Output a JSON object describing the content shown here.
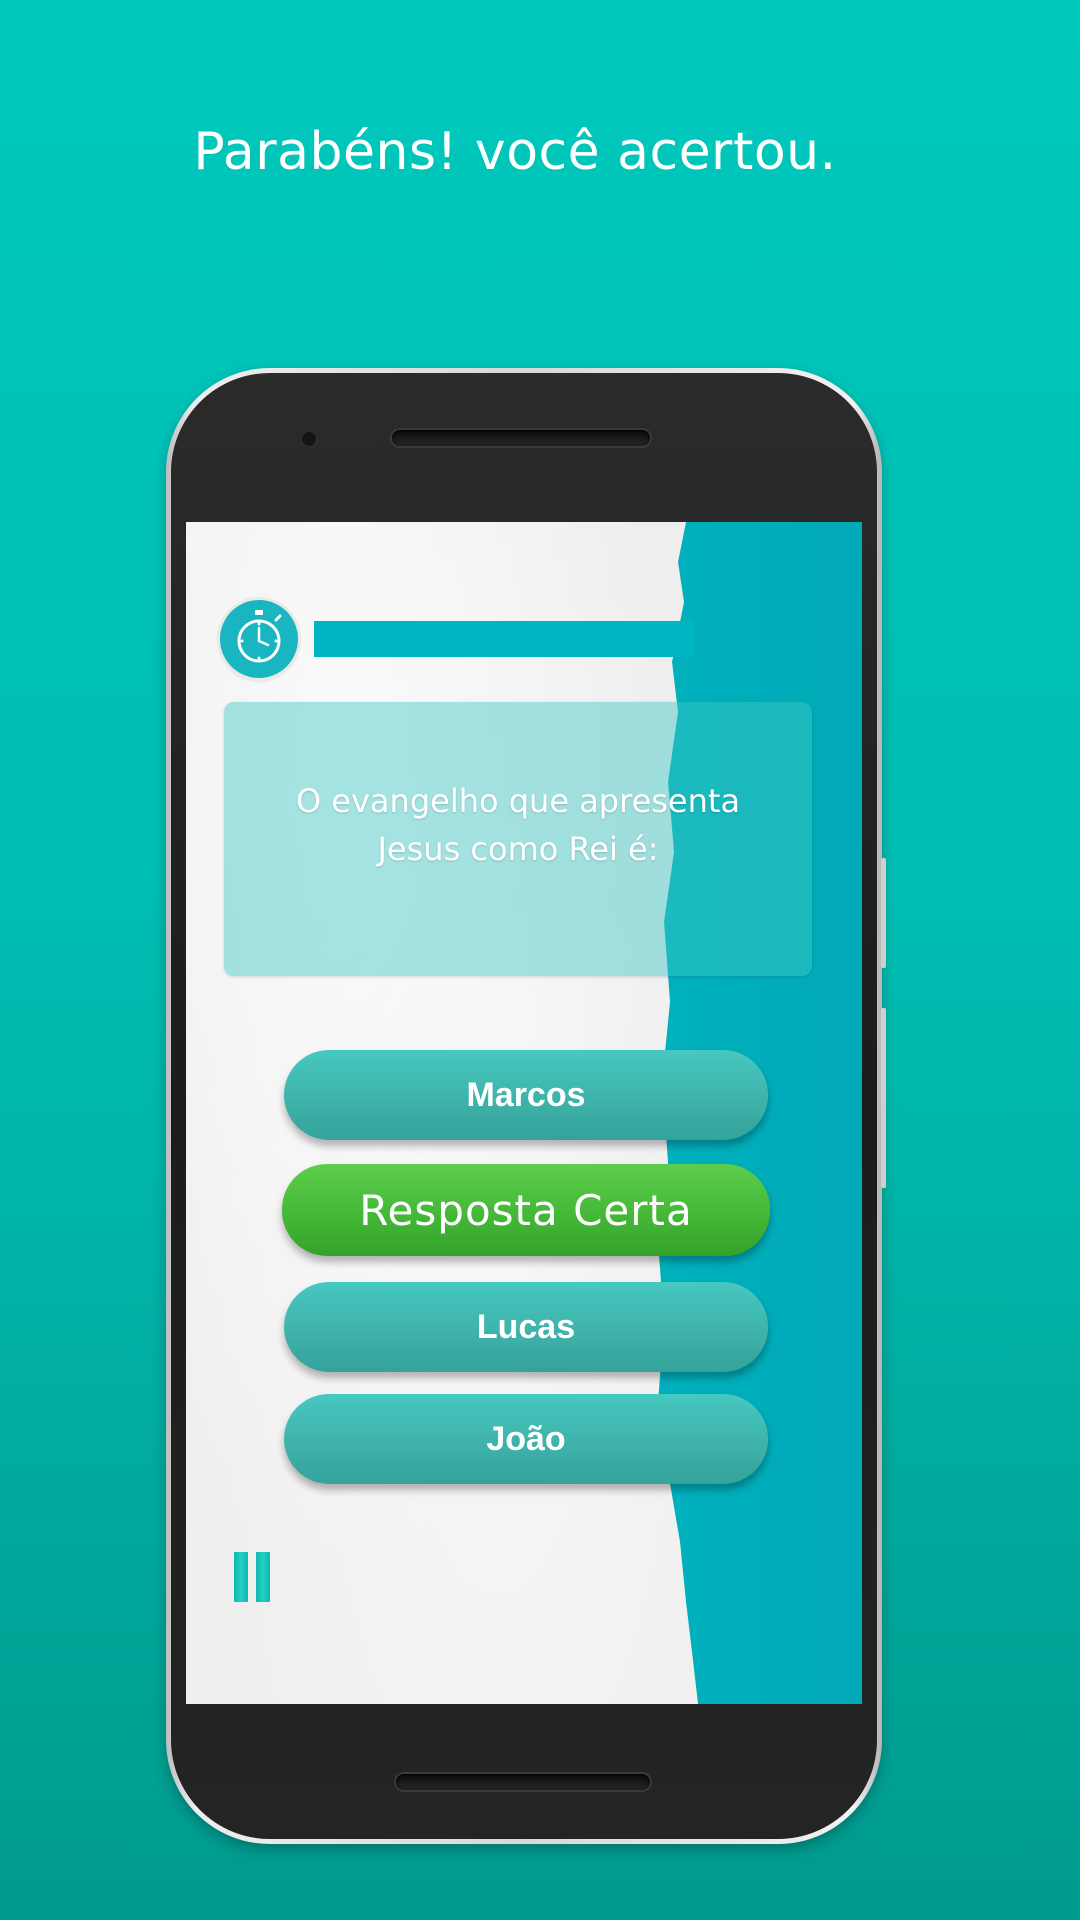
{
  "headline": "Parabéns! você acertou.",
  "question": {
    "text": "O evangelho que apresenta Jesus como Rei é:"
  },
  "timer": {
    "icon": "stopwatch-icon"
  },
  "answers": [
    {
      "label": "Marcos"
    },
    {
      "label": "Resposta Certa"
    },
    {
      "label": "Lucas"
    },
    {
      "label": "João"
    }
  ],
  "pause": {
    "icon": "pause-icon"
  },
  "colors": {
    "background": "#00c7bc",
    "answer": "#3fb3ab",
    "correct": "#45b838",
    "timer_bar": "#00b6c5"
  }
}
